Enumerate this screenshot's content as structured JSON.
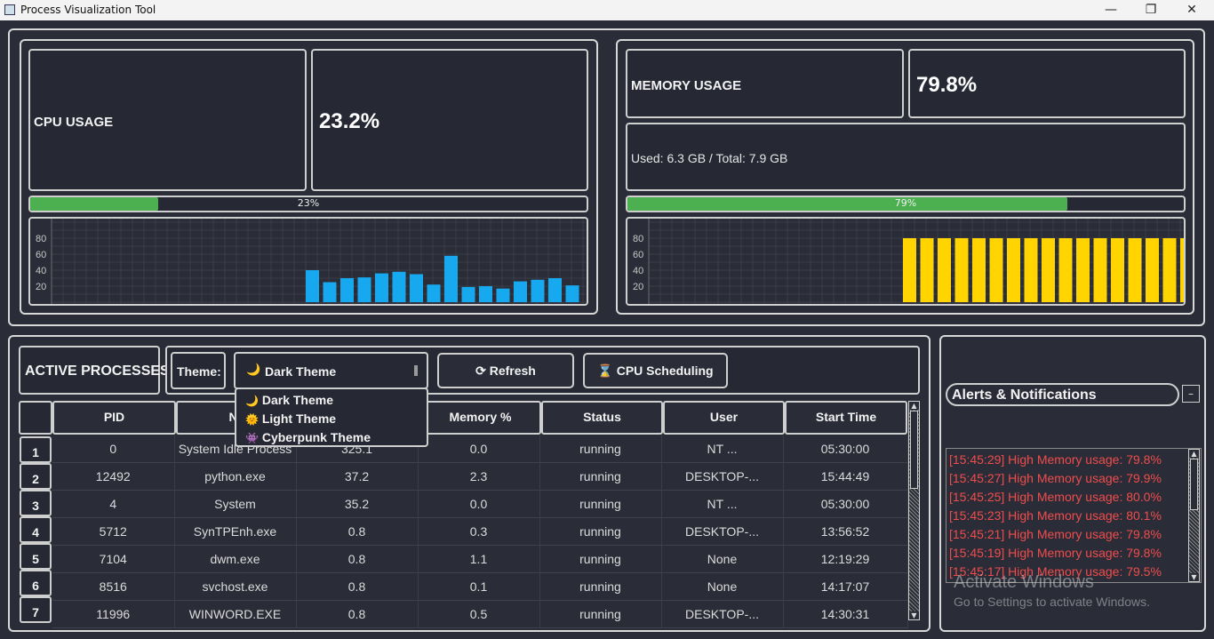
{
  "window": {
    "title": "Process Visualization Tool",
    "minimize": "—",
    "maximize": "❐",
    "close": "✕"
  },
  "cpu": {
    "label": "CPU USAGE",
    "value": "23.2%",
    "progress": 0.23,
    "progress_text": "23%",
    "graph": {
      "ticks": [
        "80",
        "60",
        "40",
        "20"
      ],
      "color": "#17a9f0",
      "max": 100,
      "values": [
        40,
        25,
        30,
        31,
        36,
        38,
        35,
        22,
        58,
        19,
        20,
        17,
        26,
        28,
        30,
        21
      ]
    }
  },
  "memory": {
    "label": "MEMORY USAGE",
    "value": "79.8%",
    "detail": "Used: 6.3 GB / Total: 7.9 GB",
    "progress": 0.79,
    "progress_text": "79%",
    "graph": {
      "ticks": [
        "80",
        "60",
        "40",
        "20"
      ],
      "color": "#ffd400",
      "max": 100,
      "values": [
        80,
        80,
        80,
        80,
        80,
        80,
        80,
        80,
        80,
        80,
        80,
        80,
        80,
        80,
        80,
        80,
        80
      ]
    }
  },
  "processes": {
    "title": "ACTIVE PROCESSES",
    "theme_label": "Theme:",
    "theme_selected": "Dark Theme",
    "theme_options": [
      {
        "icon": "🌙",
        "label": "Dark Theme"
      },
      {
        "icon": "🌞",
        "label": "Light Theme"
      },
      {
        "icon": "👾",
        "label": "Cyberpunk Theme"
      }
    ],
    "refresh_label": "⟳ Refresh",
    "cpu_sched_label": "CPU Scheduling",
    "columns": [
      "PID",
      "Na",
      "",
      "Memory %",
      "Status",
      "User",
      "Start Time"
    ],
    "rows": [
      {
        "num": "1",
        "pid": "0",
        "name": "System Idle Process",
        "cpu": "325.1",
        "mem": "0.0",
        "status": "running",
        "user": "NT ...",
        "start": "05:30:00"
      },
      {
        "num": "2",
        "pid": "12492",
        "name": "python.exe",
        "cpu": "37.2",
        "mem": "2.3",
        "status": "running",
        "user": "DESKTOP-...",
        "start": "15:44:49"
      },
      {
        "num": "3",
        "pid": "4",
        "name": "System",
        "cpu": "35.2",
        "mem": "0.0",
        "status": "running",
        "user": "NT ...",
        "start": "05:30:00"
      },
      {
        "num": "4",
        "pid": "5712",
        "name": "SynTPEnh.exe",
        "cpu": "0.8",
        "mem": "0.3",
        "status": "running",
        "user": "DESKTOP-...",
        "start": "13:56:52"
      },
      {
        "num": "5",
        "pid": "7104",
        "name": "dwm.exe",
        "cpu": "0.8",
        "mem": "1.1",
        "status": "running",
        "user": "None",
        "start": "12:19:29"
      },
      {
        "num": "6",
        "pid": "8516",
        "name": "svchost.exe",
        "cpu": "0.8",
        "mem": "0.1",
        "status": "running",
        "user": "None",
        "start": "14:17:07"
      },
      {
        "num": "7",
        "pid": "11996",
        "name": "WINWORD.EXE",
        "cpu": "0.8",
        "mem": "0.5",
        "status": "running",
        "user": "DESKTOP-...",
        "start": "14:30:31"
      }
    ]
  },
  "alerts": {
    "title": "Alerts & Notifications",
    "collapse": "–",
    "items": [
      "[15:45:29] High Memory usage: 79.8%",
      "[15:45:27] High Memory usage: 79.9%",
      "[15:45:25] High Memory usage: 80.0%",
      "[15:45:23] High Memory usage: 80.1%",
      "[15:45:21] High Memory usage: 79.8%",
      "[15:45:19] High Memory usage: 79.8%",
      "[15:45:17] High Memory usage: 79.5%"
    ]
  },
  "watermark": {
    "line1": "Activate Windows",
    "line2": "Go to Settings to activate Windows."
  },
  "colors": {
    "background": "#2a2c37",
    "progress_fill": "#4caf50",
    "alert_text": "#ef4d4d"
  }
}
